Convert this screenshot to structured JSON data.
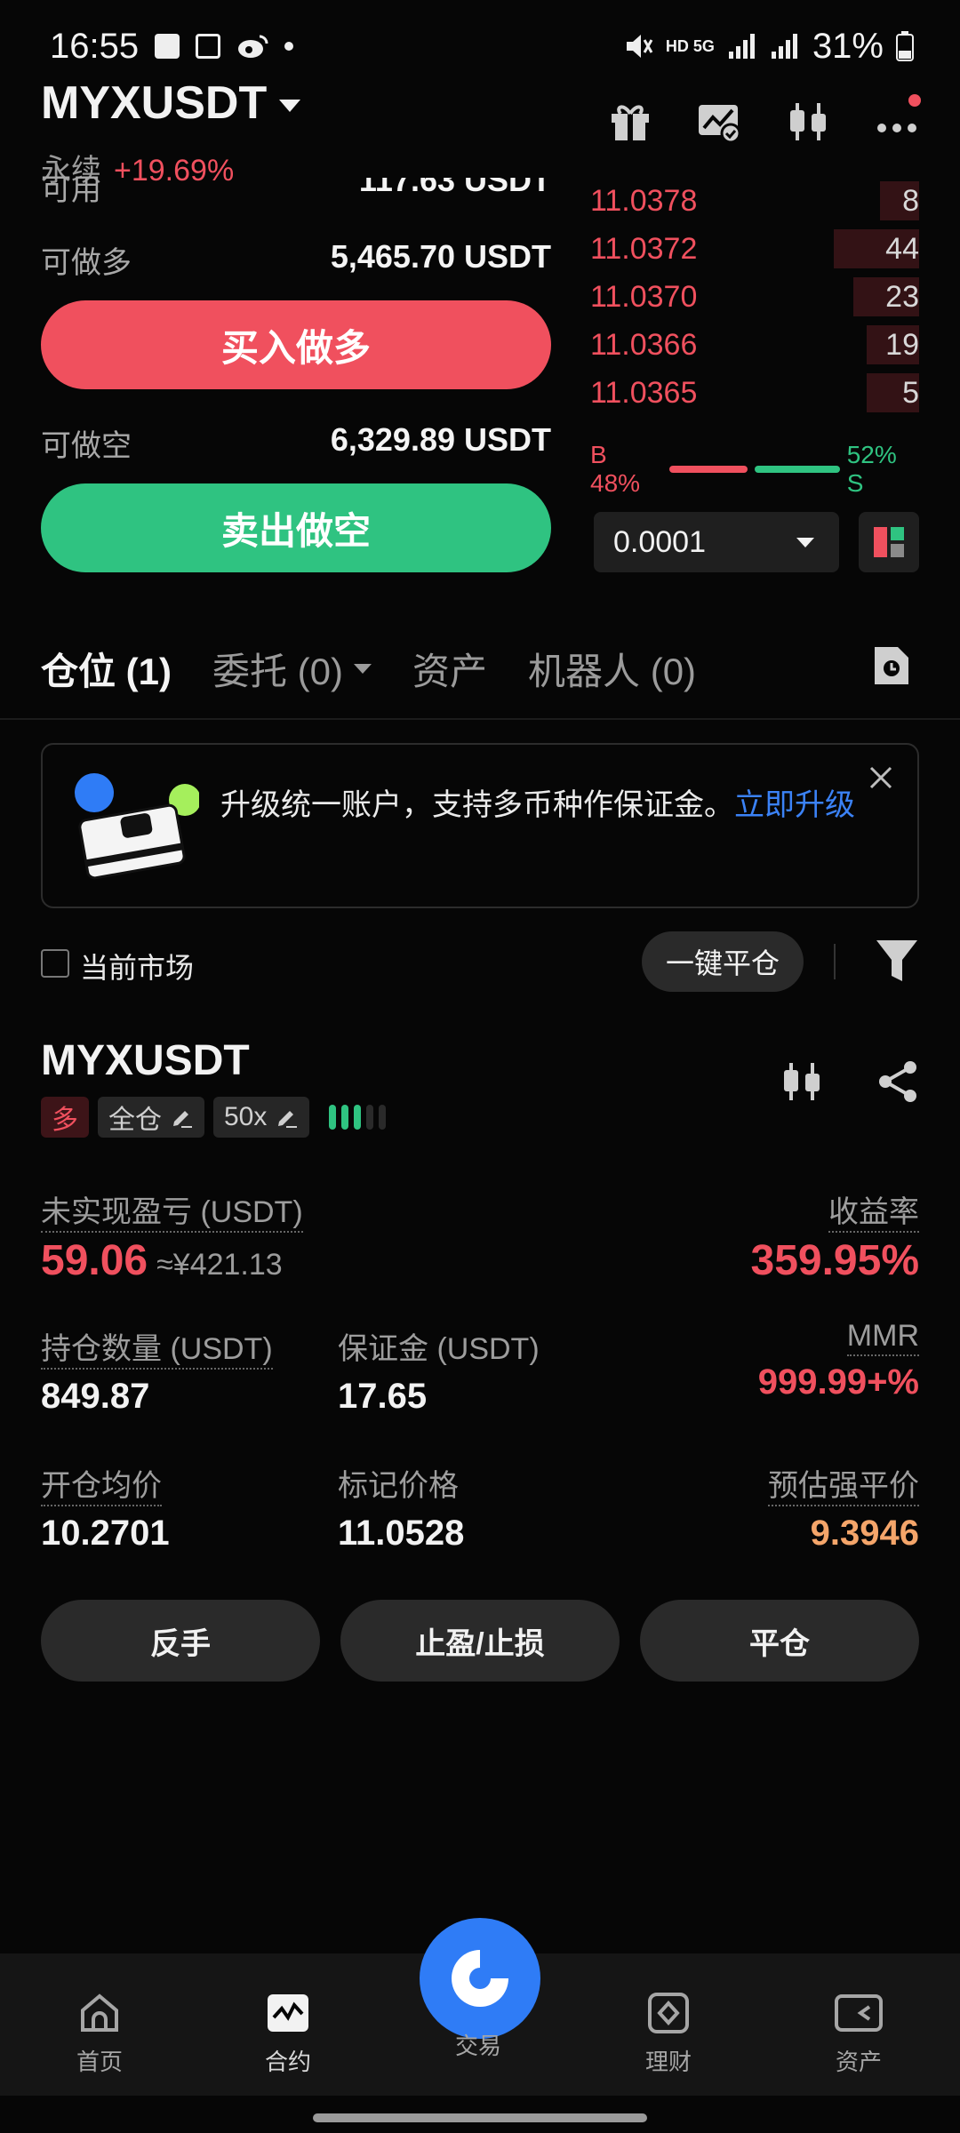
{
  "status_bar": {
    "time": "16:55",
    "network": "HD 5G",
    "battery": "31%"
  },
  "header": {
    "pair": "MYXUSDT",
    "contract_type": "永续",
    "change": "+19.69%",
    "icons": [
      "gift-icon",
      "chart-check-icon",
      "candlestick-icon",
      "more-icon"
    ]
  },
  "order_panel": {
    "available_label": "可用",
    "available_value": "117.63 USDT",
    "can_long_label": "可做多",
    "can_long_value": "5,465.70 USDT",
    "buy_label": "买入做多",
    "can_short_label": "可做空",
    "can_short_value": "6,329.89 USDT",
    "sell_label": "卖出做空"
  },
  "order_book": {
    "asks": [
      {
        "price": "11.0378",
        "qty": "8",
        "depth": 0.12
      },
      {
        "price": "11.0372",
        "qty": "44",
        "depth": 0.26
      },
      {
        "price": "11.0370",
        "qty": "23",
        "depth": 0.2
      },
      {
        "price": "11.0366",
        "qty": "19",
        "depth": 0.16
      },
      {
        "price": "11.0365",
        "qty": "5",
        "depth": 0.16
      }
    ],
    "buy_ratio_label": "B 48%",
    "sell_ratio_label": "52% S",
    "buy_ratio": 0.48,
    "precision": "0.0001"
  },
  "tabs": [
    {
      "label": "仓位 (1)",
      "active": true
    },
    {
      "label": "委托 (0)",
      "active": false
    },
    {
      "label": "资产",
      "active": false
    },
    {
      "label": "机器人 (0)",
      "active": false
    }
  ],
  "banner": {
    "text": "升级统一账户，支持多币种作保证金。",
    "link": "立即升级"
  },
  "filter_row": {
    "current_market_label": "当前市场",
    "close_all_label": "一键平仓"
  },
  "position": {
    "symbol": "MYXUSDT",
    "side_tag": "多",
    "margin_mode": "全仓",
    "leverage": "50x",
    "leverage_level": 3,
    "unrealized_pnl_label": "未实现盈亏 (USDT)",
    "unrealized_pnl": "59.06",
    "unrealized_pnl_cny": "≈¥421.13",
    "roe_label": "收益率",
    "roe": "359.95%",
    "size_label": "持仓数量 (USDT)",
    "size": "849.87",
    "margin_label": "保证金 (USDT)",
    "margin": "17.65",
    "mmr_label": "MMR",
    "mmr": "999.99+%",
    "entry_label": "开仓均价",
    "entry": "10.2701",
    "mark_label": "标记价格",
    "mark": "11.0528",
    "liq_label": "预估强平价",
    "liq": "9.3946",
    "actions": [
      "反手",
      "止盈/止损",
      "平仓"
    ]
  },
  "bottom_nav": [
    {
      "label": "首页",
      "icon": "home-icon"
    },
    {
      "label": "合约",
      "icon": "futures-icon"
    },
    {
      "label": "交易",
      "icon": "trade-icon"
    },
    {
      "label": "理财",
      "icon": "earn-icon"
    },
    {
      "label": "资产",
      "icon": "wallet-icon"
    }
  ],
  "colors": {
    "red": "#f0505e",
    "green": "#2fc381",
    "blue": "#2f7cf6",
    "orange": "#f4a56a"
  }
}
